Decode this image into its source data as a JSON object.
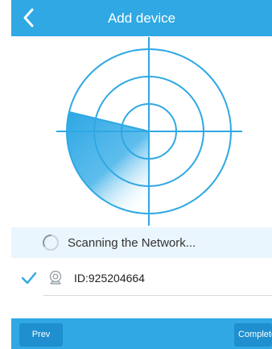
{
  "header": {
    "title": "Add device",
    "back_icon": "chevron-left-icon"
  },
  "radar": {
    "icon": "radar-scan-icon",
    "color": "#2fa8e4"
  },
  "status": {
    "text": "Scanning the Network...",
    "icon": "loading-spinner-icon"
  },
  "devices": [
    {
      "id_label": "ID:925204664",
      "selected": true,
      "icon": "camera-icon"
    }
  ],
  "footer": {
    "prev_label": "Prev",
    "complete_label": "Complete"
  },
  "colors": {
    "accent": "#2fa8e4",
    "button": "#1f8fcf",
    "status_bg": "#eaf6fd"
  }
}
